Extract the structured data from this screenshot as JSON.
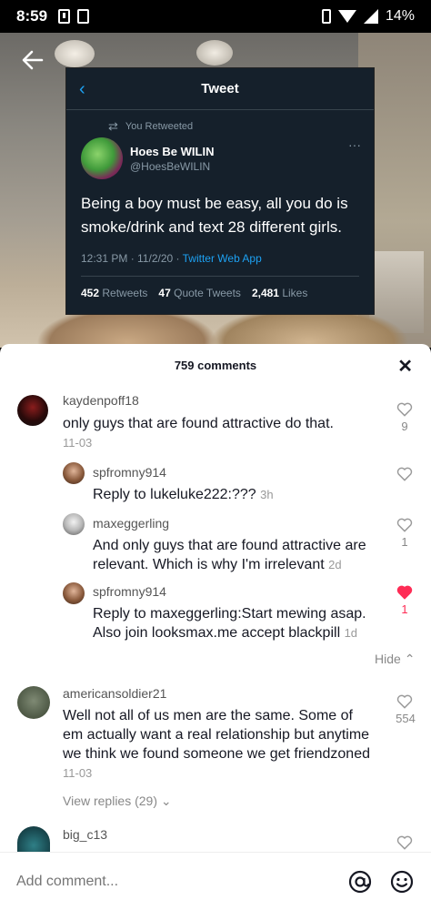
{
  "status": {
    "time": "8:59",
    "battery": "14%"
  },
  "tweet": {
    "header_title": "Tweet",
    "retweeted_label": "You Retweeted",
    "author_name": "Hoes Be WILIN",
    "author_handle": "@HoesBeWILIN",
    "body": "Being a boy must be easy, all you do is smoke/drink and text 28 different girls.",
    "time": "12:31 PM · 11/2/20 · ",
    "app": "Twitter Web App",
    "retweets": "452",
    "retweets_label": "Retweets",
    "quote_tweets": "47",
    "quote_tweets_label": "Quote Tweets",
    "likes": "2,481",
    "likes_label": "Likes"
  },
  "sheet": {
    "title": "759 comments",
    "hide_label": "Hide",
    "view_replies_label": "View replies (29)",
    "add_comment_placeholder": "Add comment..."
  },
  "comments": [
    {
      "username": "kaydenpoff18",
      "text": "only guys that are found attractive do that.",
      "date": "11-03",
      "likes": "9",
      "liked": false
    },
    {
      "username": "spfromny914",
      "reply_prefix": "Reply to ",
      "mention": "lukeluke222",
      "text": ":???",
      "date": "3h",
      "likes": "",
      "liked": false
    },
    {
      "username": "maxeggerling",
      "text": "And only guys that are found attractive are relevant. Which is why I'm irrelevant",
      "date": "2d",
      "likes": "1",
      "liked": false
    },
    {
      "username": "spfromny914",
      "reply_prefix": "Reply to ",
      "mention": "maxeggerling",
      "text": ":Start mewing asap. Also join looksmax.me accept blackpill",
      "date": "1d",
      "likes": "1",
      "liked": true
    },
    {
      "username": "americansoldier21",
      "text": "Well not all of us men are the same. Some of em actually want a real relationship but anytime we think we found someone we get friendzoned",
      "date": "11-03",
      "likes": "554",
      "liked": false
    },
    {
      "username": "big_c13",
      "text": "",
      "date": "",
      "likes": "",
      "liked": false
    }
  ],
  "colors": {
    "liked_heart": "#fe2c55",
    "tweet_bg": "#15202b",
    "twitter_blue": "#1da1f2"
  }
}
